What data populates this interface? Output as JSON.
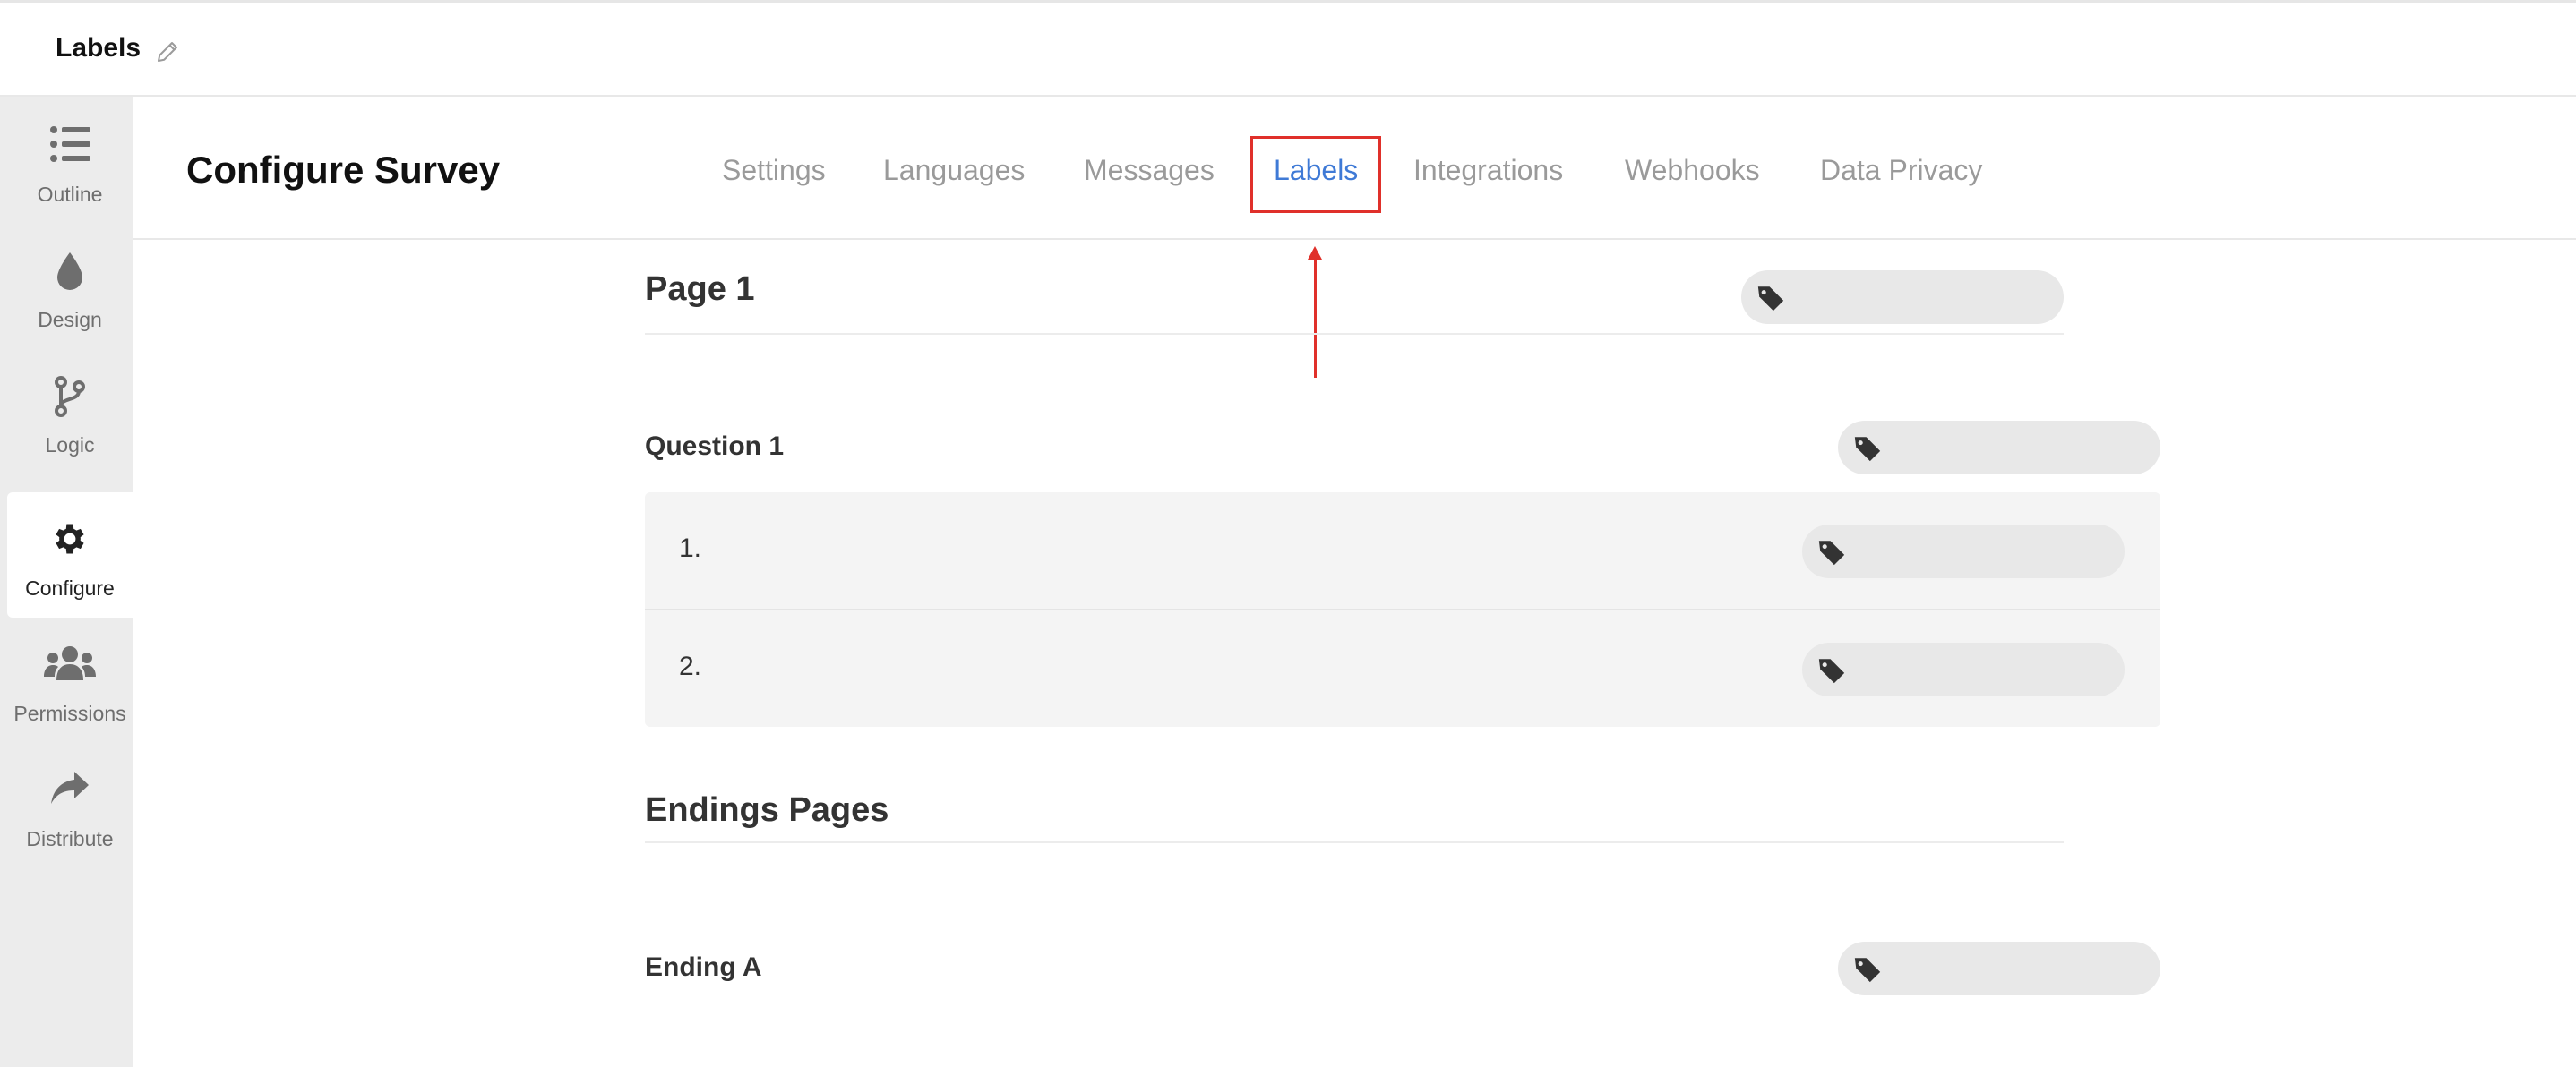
{
  "topbar": {
    "title": "Labels",
    "edit_icon": "pencil-icon"
  },
  "sidebar": {
    "items": [
      {
        "label": "Outline",
        "icon": "list-icon",
        "active": false
      },
      {
        "label": "Design",
        "icon": "droplet-icon",
        "active": false
      },
      {
        "label": "Logic",
        "icon": "branch-icon",
        "active": false
      },
      {
        "label": "Configure",
        "icon": "gear-icon",
        "active": true
      },
      {
        "label": "Permissions",
        "icon": "users-icon",
        "active": false
      },
      {
        "label": "Distribute",
        "icon": "share-icon",
        "active": false
      }
    ]
  },
  "header": {
    "title": "Configure Survey",
    "tabs": [
      {
        "label": "Settings",
        "active": false
      },
      {
        "label": "Languages",
        "active": false
      },
      {
        "label": "Messages",
        "active": false
      },
      {
        "label": "Labels",
        "active": true
      },
      {
        "label": "Integrations",
        "active": false
      },
      {
        "label": "Webhooks",
        "active": false
      },
      {
        "label": "Data Privacy",
        "active": false
      }
    ]
  },
  "colors": {
    "accent": "#3f7ad6",
    "highlight": "#e0302a",
    "sidebar_bg": "#ececec",
    "pill_bg": "#e8e8e8"
  },
  "content": {
    "page_section": {
      "title": "Page 1"
    },
    "question": {
      "title": "Question 1",
      "choices": [
        {
          "label": "1."
        },
        {
          "label": "2."
        }
      ]
    },
    "endings_section": {
      "title": "Endings Pages"
    },
    "ending": {
      "title": "Ending A"
    }
  }
}
